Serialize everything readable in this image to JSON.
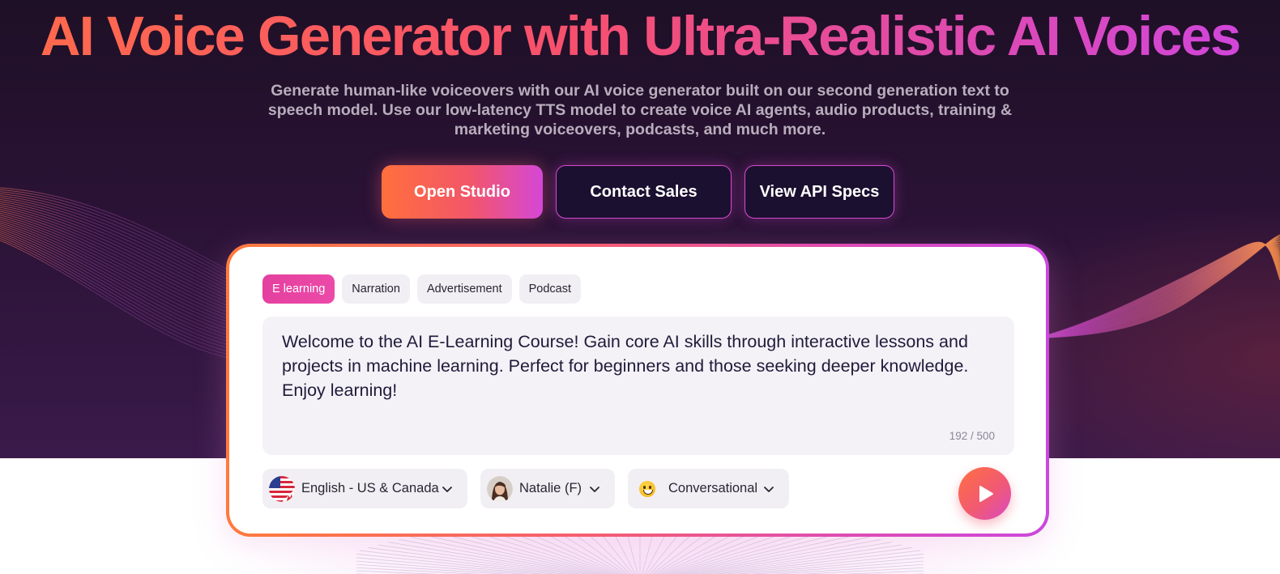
{
  "hero": {
    "headline": "AI Voice Generator with Ultra-Realistic AI Voices",
    "subtitle": "Generate human-like voiceovers with our AI voice generator built on our second generation text to speech model. Use our low-latency TTS model to create voice AI agents, audio products, training & marketing voiceovers, podcasts, and much more.",
    "buttons": {
      "open_studio": "Open Studio",
      "contact_sales": "Contact Sales",
      "view_api": "View API Specs"
    }
  },
  "demo": {
    "tabs": [
      {
        "label": "E learning",
        "active": true
      },
      {
        "label": "Narration",
        "active": false
      },
      {
        "label": "Advertisement",
        "active": false
      },
      {
        "label": "Podcast",
        "active": false
      }
    ],
    "text": "Welcome to the AI E-Learning Course! Gain core AI skills through interactive lessons and projects in machine learning. Perfect for beginners and those seeking deeper knowledge. Enjoy learning!",
    "counter": "192 / 500",
    "language": {
      "label": "English - US & Canada",
      "icon": "us-canada-flag-icon"
    },
    "voice": {
      "label": "Natalie (F)",
      "icon": "avatar"
    },
    "style": {
      "label": "Conversational",
      "icon": "grinning-emoji-icon"
    },
    "play_icon": "play-icon"
  },
  "colors": {
    "accent_orange": "#ff6b4a",
    "accent_pink": "#e4409f",
    "accent_purple": "#cf45e0",
    "hero_bg": "#1e1026"
  }
}
